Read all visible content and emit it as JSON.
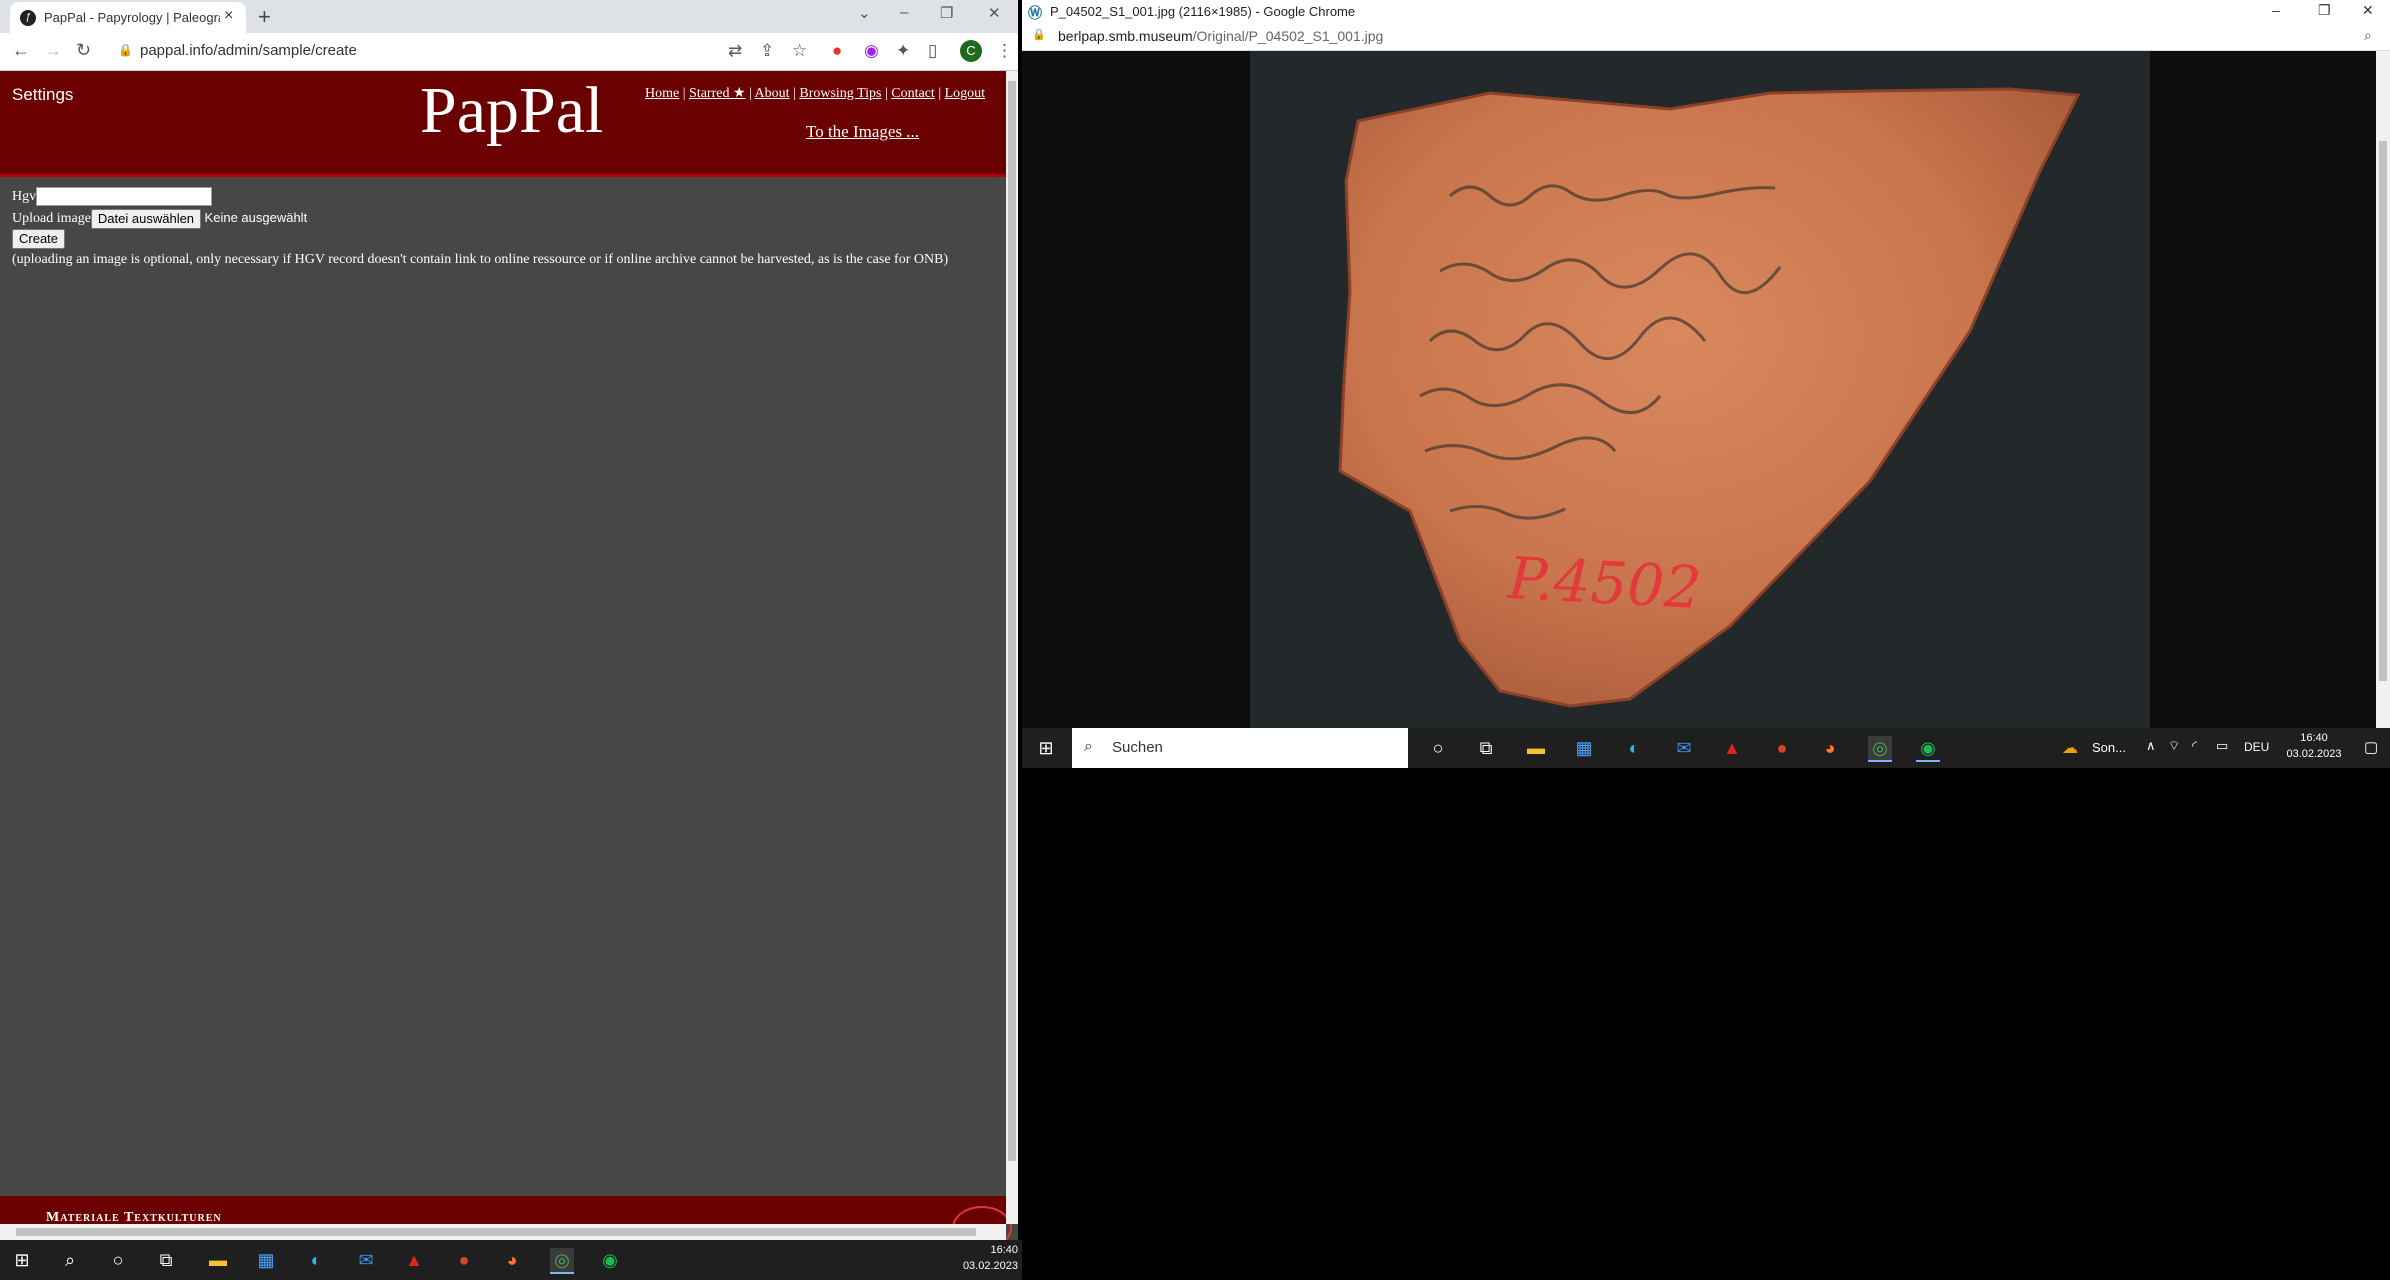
{
  "left_browser": {
    "tab_title": "PapPal - Papyrology | Paleography",
    "url": "pappal.info/admin/sample/create",
    "profile_initial": "C"
  },
  "site": {
    "settings_label": "Settings",
    "logo": "PapPal",
    "nav": [
      "Home",
      "Starred ★",
      "About",
      "Browsing Tips",
      "Contact",
      "Logout"
    ],
    "to_images": "To the Images ...",
    "form": {
      "hgv_label": "Hgv",
      "hgv_value": "",
      "upload_label": "Upload image",
      "file_button": "Datei auswählen",
      "file_status": "Keine ausgewählt",
      "create_button": "Create",
      "note": "(uploading an image is optional, only necessary if HGV record doesn't contain link to online ressource or if online archive cannot be harvested, as is the case for ONB)"
    },
    "footer_text": "Materiale Textkulturen"
  },
  "right_browser": {
    "title": "P_04502_S1_001.jpg (2116×1985) - Google Chrome",
    "url_host": "berlpap.smb.museum",
    "url_path": "/Original/P_04502_S1_001.jpg",
    "image_label": "P.4502"
  },
  "taskbar_left": {
    "time": "16:40",
    "date": "03.02.2023"
  },
  "taskbar_right": {
    "search_placeholder": "Suchen",
    "weather": "Son...",
    "lang": "DEU",
    "time": "16:40",
    "date": "03.02.2023"
  },
  "colors": {
    "site_header": "#6b0000",
    "site_body": "#474747",
    "taskbar": "#1f1f1f"
  }
}
